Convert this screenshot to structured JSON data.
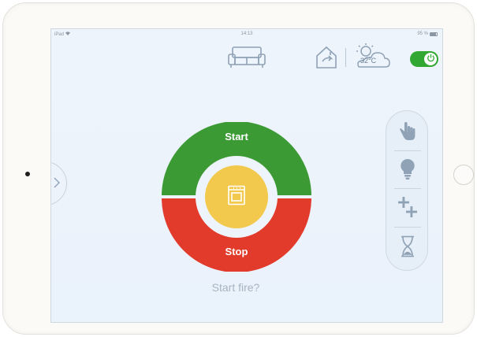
{
  "status_bar": {
    "device": "iPad",
    "time": "14:13",
    "battery": "95 %"
  },
  "header": {
    "temperature": "32°C"
  },
  "dial": {
    "start_label": "Start",
    "stop_label": "Stop"
  },
  "prompt": "Start fire?",
  "colors": {
    "start": "#3c9a35",
    "stop": "#e23b2c",
    "center": "#f2c94c",
    "toggle_on": "#32a832",
    "icon": "#8fa2b6"
  },
  "power_toggle": {
    "on": true
  },
  "right_panel": {
    "items": [
      "hand-pointer-icon",
      "lightbulb-icon",
      "plus-plus-icon",
      "hourglass-icon"
    ]
  }
}
